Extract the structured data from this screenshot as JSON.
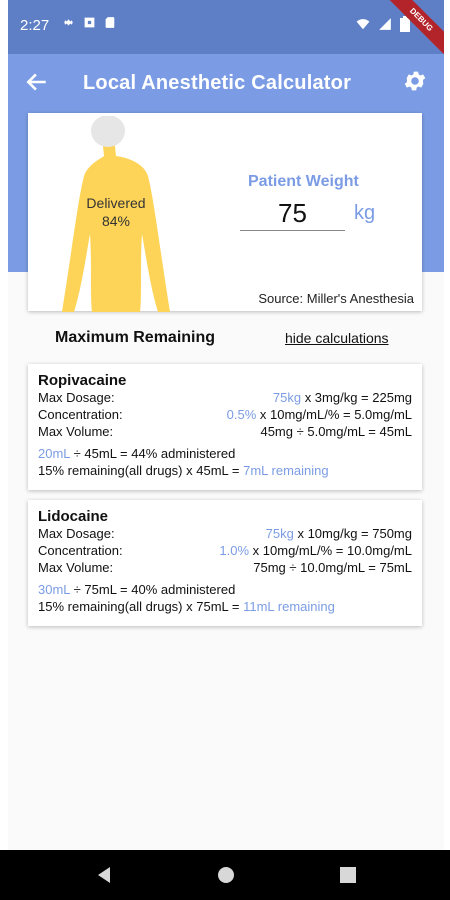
{
  "status_bar": {
    "time": "2:27",
    "banner": "DEBUG"
  },
  "app_bar": {
    "title": "Local Anesthetic Calculator"
  },
  "patient": {
    "delivered_label": "Delivered",
    "delivered_percent": "84%",
    "weight_label": "Patient Weight",
    "weight_value": "75",
    "weight_unit": "kg",
    "source": "Source: Miller's Anesthesia"
  },
  "section": {
    "title": "Maximum Remaining",
    "toggle_label": "hide calculations"
  },
  "drugs": [
    {
      "name": "Ropivacaine",
      "max_dosage_label": "Max Dosage:",
      "max_dosage_weight": "75kg",
      "max_dosage_rest": " x 3mg/kg = 225mg",
      "concentration_label": "Concentration:",
      "concentration_pct": "0.5%",
      "concentration_rest": " x 10mg/mL/% = 5.0mg/mL",
      "max_volume_label": "Max Volume:",
      "max_volume_value": "45mg ÷ 5.0mg/mL = 45mL",
      "administered_ml": "20mL",
      "administered_rest": " ÷ 45mL = 44% administered",
      "remaining_prefix": "15% remaining(all drugs) x 45mL = ",
      "remaining_value": "7mL remaining"
    },
    {
      "name": "Lidocaine",
      "max_dosage_label": "Max Dosage:",
      "max_dosage_weight": "75kg",
      "max_dosage_rest": " x 10mg/kg = 750mg",
      "concentration_label": "Concentration:",
      "concentration_pct": "1.0%",
      "concentration_rest": " x 10mg/mL/% = 10.0mg/mL",
      "max_volume_label": "Max Volume:",
      "max_volume_value": "75mg ÷ 10.0mg/mL = 75mL",
      "administered_ml": "30mL",
      "administered_rest": " ÷ 75mL = 40% administered",
      "remaining_prefix": "15% remaining(all drugs) x 75mL = ",
      "remaining_value": "11mL remaining"
    }
  ],
  "colors": {
    "status_bar": "#5e7fc6",
    "accent": "#7b9ce4",
    "figure": "#fed458",
    "head": "#e6e6e6"
  },
  "icons": [
    "gear-icon",
    "square-icon",
    "sd-card-icon",
    "wifi-icon",
    "signal-icon",
    "battery-icon",
    "back-arrow-icon",
    "settings-gear-icon",
    "nav-back-icon",
    "nav-home-icon",
    "nav-recents-icon"
  ]
}
